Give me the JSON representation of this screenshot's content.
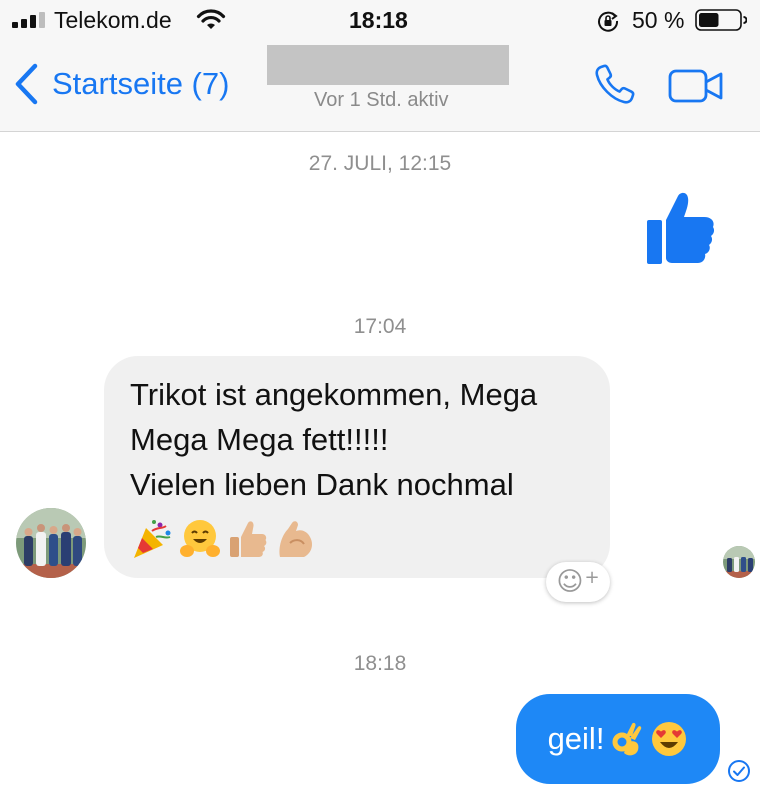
{
  "status_bar": {
    "carrier": "Telekom.de",
    "time": "18:18",
    "battery_percent": "50 %",
    "battery_level": 0.5,
    "icons": [
      "signal-icon",
      "wifi-icon",
      "rotation-lock-icon",
      "battery-icon"
    ]
  },
  "nav": {
    "back_label": "Startseite (7)",
    "presence": "Vor 1 Std. aktiv",
    "icons": [
      "back-chevron-icon",
      "phone-icon",
      "video-camera-icon"
    ],
    "accent": "#1877f2"
  },
  "chat": {
    "timestamps": [
      "27. JULI, 12:15",
      "17:04",
      "18:18"
    ],
    "messages": [
      {
        "direction": "out",
        "kind": "sticker",
        "icon": "thumbs-up-icon"
      },
      {
        "direction": "in",
        "text": "Trikot ist angekommen, Mega\nMega Mega fett!!!!!\nVielen lieben Dank nochmal",
        "emojis": [
          "party-popper-icon",
          "hugging-face-icon",
          "thumbs-up-icon",
          "flexed-biceps-icon"
        ]
      },
      {
        "direction": "out",
        "text": "geil!",
        "emojis": [
          "ok-hand-icon",
          "heart-eyes-icon"
        ]
      }
    ],
    "reaction_button": {
      "face": "☺",
      "plus": "+"
    },
    "colors": {
      "outgoing": "#1e88f6",
      "incoming": "#f0f0f0"
    }
  }
}
